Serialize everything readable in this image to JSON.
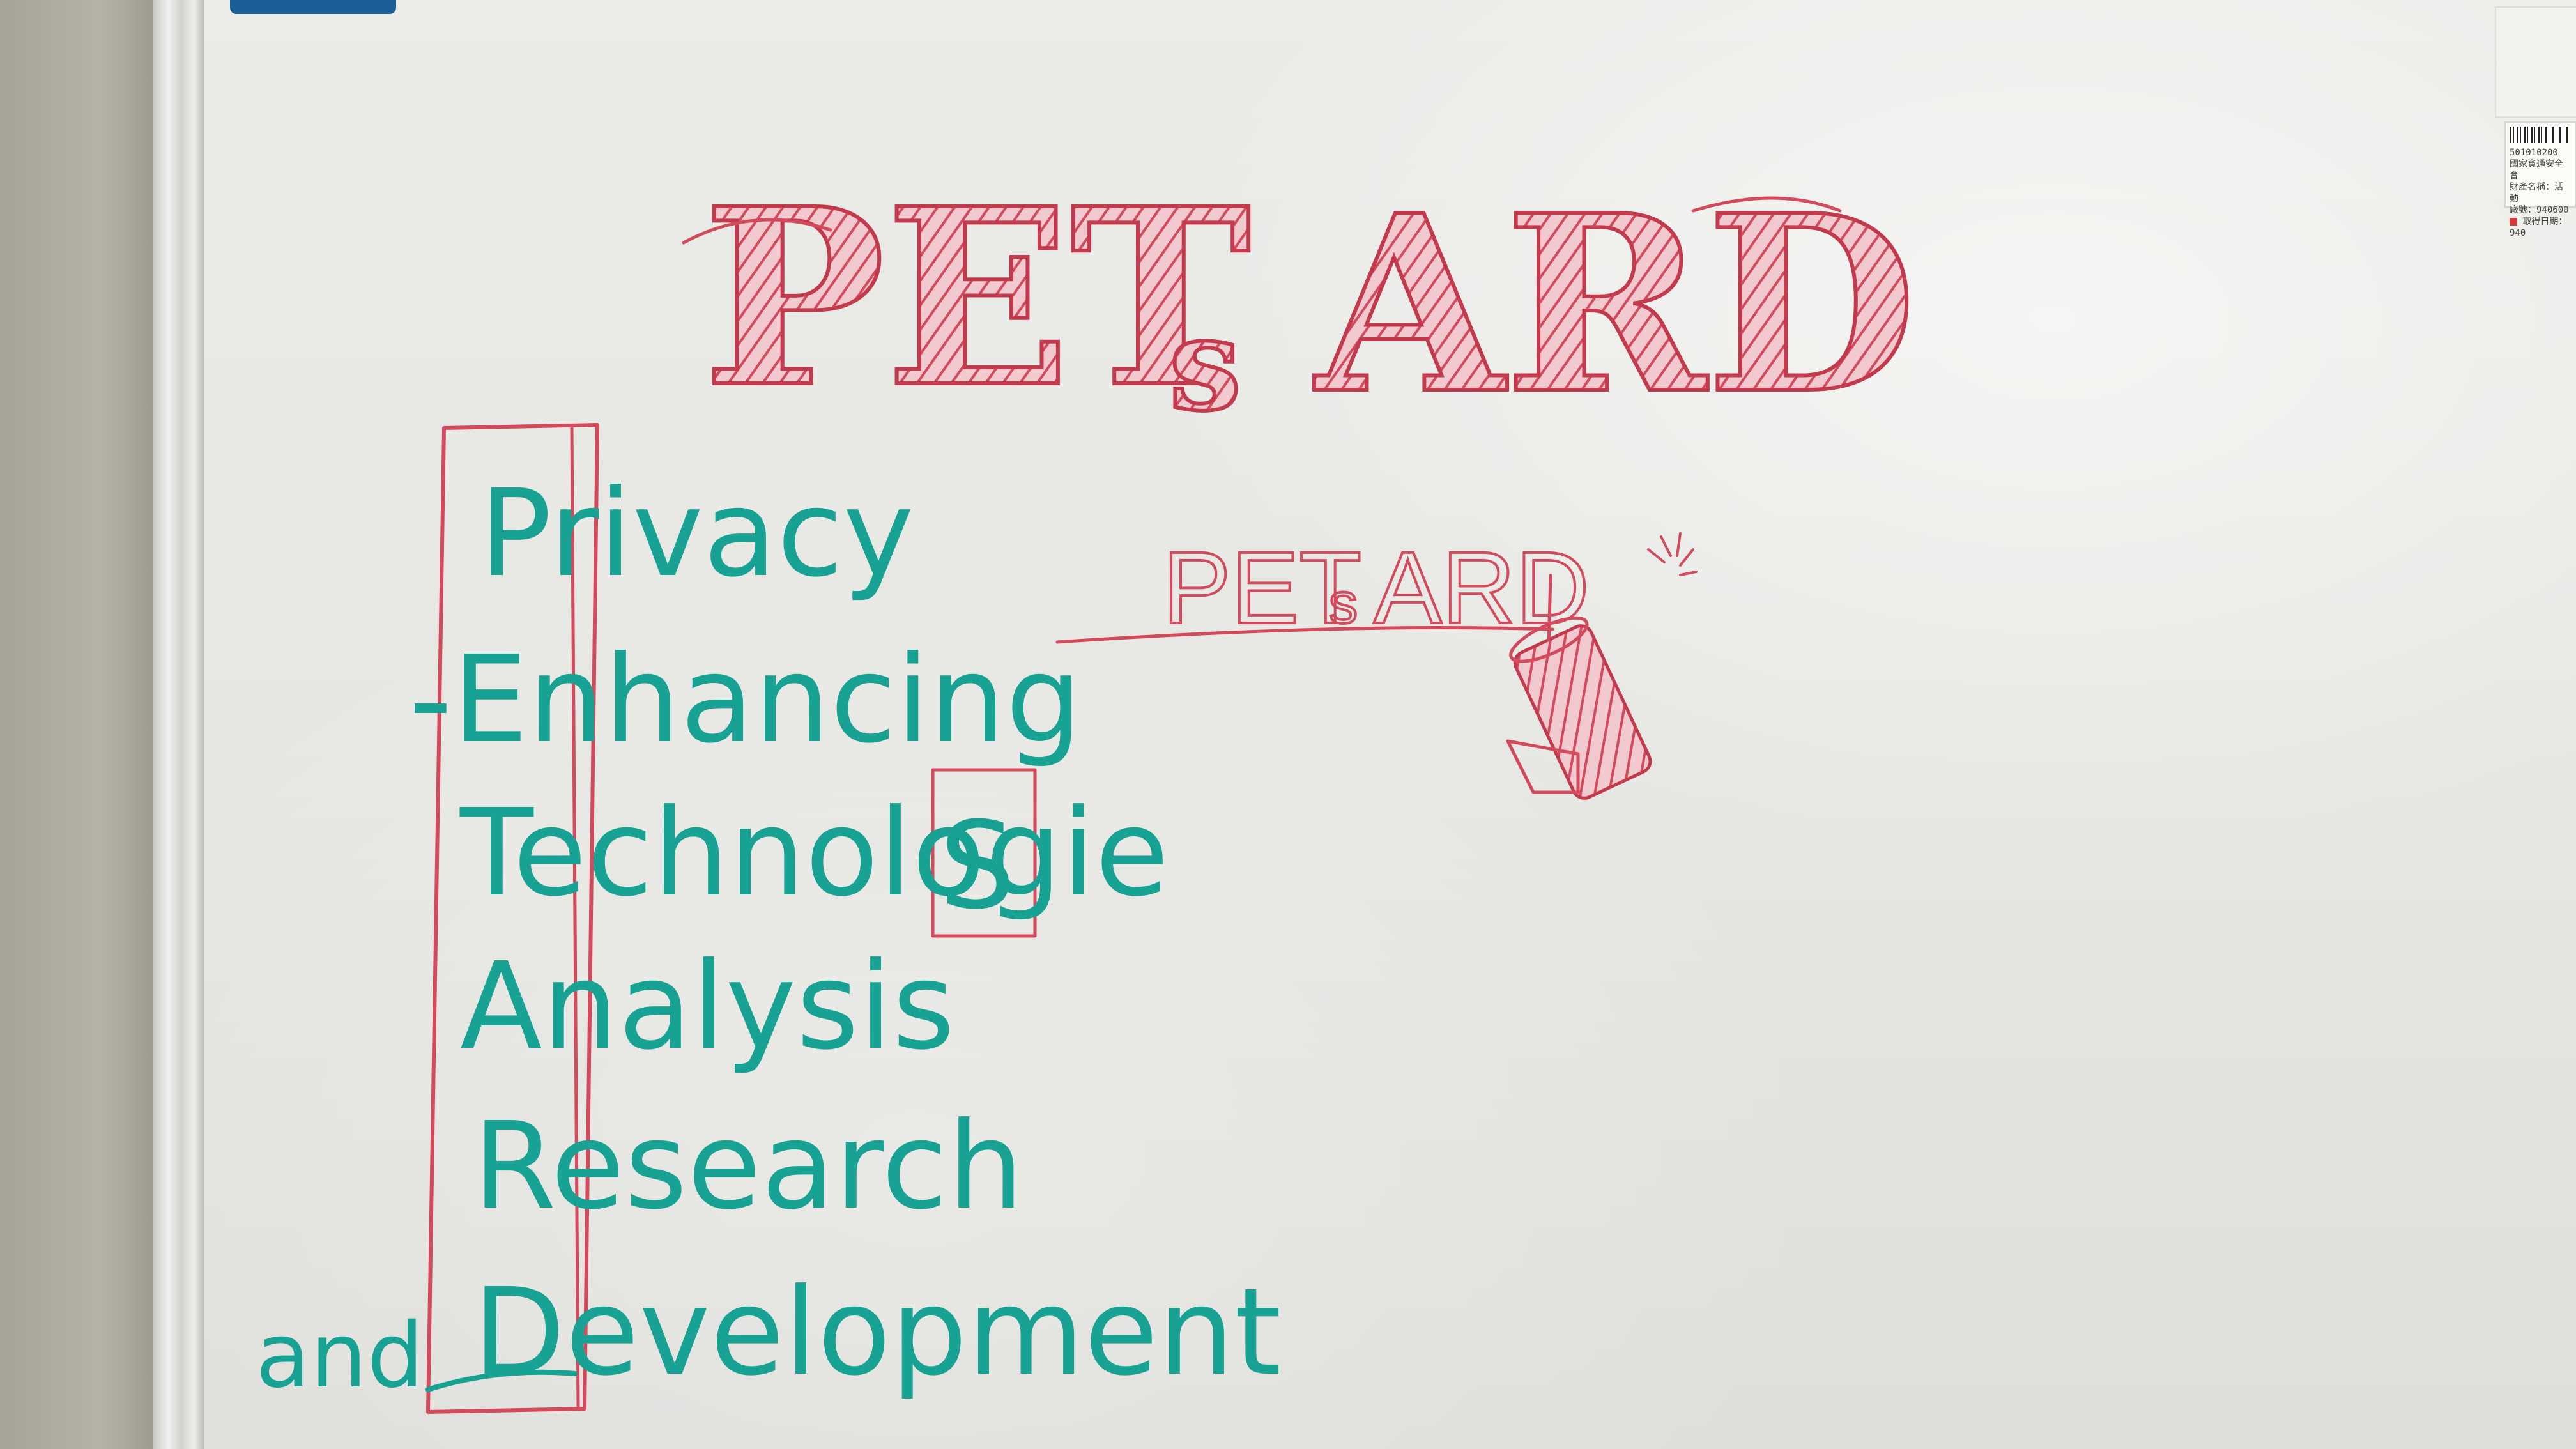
{
  "scene": {
    "colors": {
      "red_marker": "#d24a5c",
      "teal_marker": "#18a294",
      "board": "#e8e8e4",
      "frame": "#e4e4e1"
    }
  },
  "whiteboard": {
    "title": {
      "part1": "PET",
      "small_s": "s",
      "part2": "ARD"
    },
    "subtitle": {
      "part1": "PET",
      "small_s": "s",
      "part2": "ARD"
    },
    "acronym_lines": [
      "Privacy",
      "-Enhancing",
      "Technologie",
      "Analysis",
      "Research",
      "Development"
    ],
    "boxed_letter": "S",
    "and_word": "and"
  },
  "asset_label": {
    "number": "501010200",
    "line2": "國家資通安全會",
    "line3": "財產名稱：活動",
    "line4": "廠號：940600",
    "line5": "取得日期：940"
  }
}
